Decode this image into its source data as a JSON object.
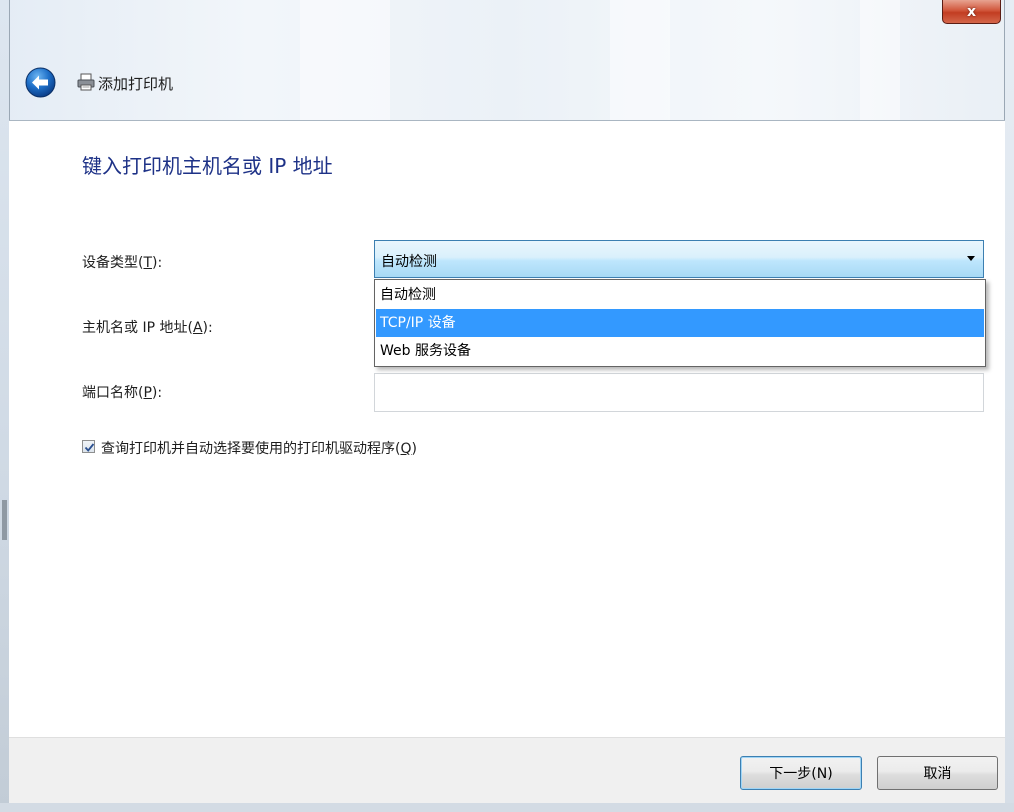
{
  "window": {
    "title": "添加打印机",
    "close_glyph": "x"
  },
  "page": {
    "heading": "键入打印机主机名或 IP 地址"
  },
  "form": {
    "device_type": {
      "label_text": "设备类型(",
      "label_key": "T",
      "label_suffix": "):",
      "value": "自动检测",
      "options": [
        "自动检测",
        "TCP/IP 设备",
        "Web 服务设备"
      ],
      "highlighted_option": "TCP/IP 设备"
    },
    "hostname": {
      "label_text": "主机名或 IP 地址(",
      "label_key": "A",
      "label_suffix": "):",
      "value": ""
    },
    "port_name": {
      "label_text": "端口名称(",
      "label_key": "P",
      "label_suffix": "):",
      "value": ""
    },
    "query_printer": {
      "checked": true,
      "label_text": "查询打印机并自动选择要使用的打印机驱动程序(",
      "label_key": "Q",
      "label_suffix": ")"
    }
  },
  "footer": {
    "next_label": "下一步(N)",
    "cancel_label": "取消"
  },
  "colors": {
    "heading": "#1e3287",
    "selection": "#3399ff",
    "close_button": "#c23d22",
    "back_arrow": "#1e6fc8"
  },
  "icons": {
    "back": "back-arrow-icon",
    "printer": "printer-icon",
    "checkmark": "checkmark-icon",
    "dropdown": "dropdown-arrow-icon"
  }
}
